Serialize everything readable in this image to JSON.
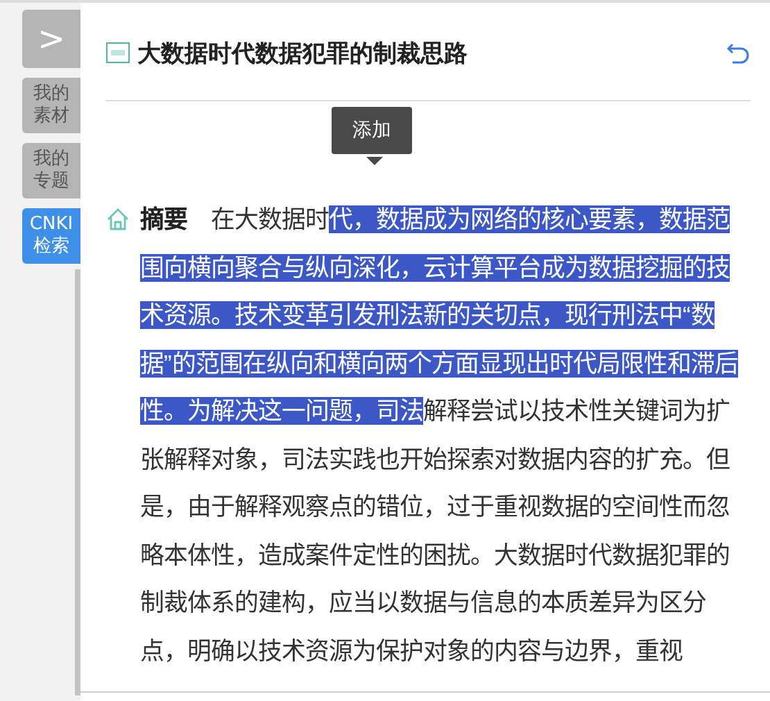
{
  "sidebar": {
    "items": [
      {
        "kind": "toggle",
        "label": ">",
        "selected": false
      },
      {
        "kind": "tab",
        "label": "我的素材",
        "selected": false
      },
      {
        "kind": "tab",
        "label": "我的专题",
        "selected": false
      },
      {
        "kind": "tab",
        "label": "CNKI检索",
        "selected": true
      }
    ]
  },
  "article": {
    "title": "大数据时代数据犯罪的制裁思路",
    "tooltip": "添加",
    "abstract": [
      {
        "text": "**摘要**　在大数据时",
        "selected": false
      },
      {
        "text": "代，数据成为网络的核心要素，数据范围向横向聚合与纵向深化，云计算平台成为数据挖掘的技术资源。技术变革引发刑法新的关切点，现行刑法中“数据”的范围在纵向和横向两个方面显现出时代局限性和滞后性。为解决这一问题，司法",
        "selected": true
      },
      {
        "text": "解释尝试以技术性关键词为扩张解释对象，司法实践也开始探索对数据内容的扩充。但是，由于解释观察点的错位，过于重视数据的空间性而忽略本体性，造成案件定性的困扰。大数据时代数据犯罪的制裁体系的建构，应当以数据与信息的本质差异为区分点，明确以技术资源为保护对象的内容与边界，重视",
        "selected": false
      }
    ]
  }
}
